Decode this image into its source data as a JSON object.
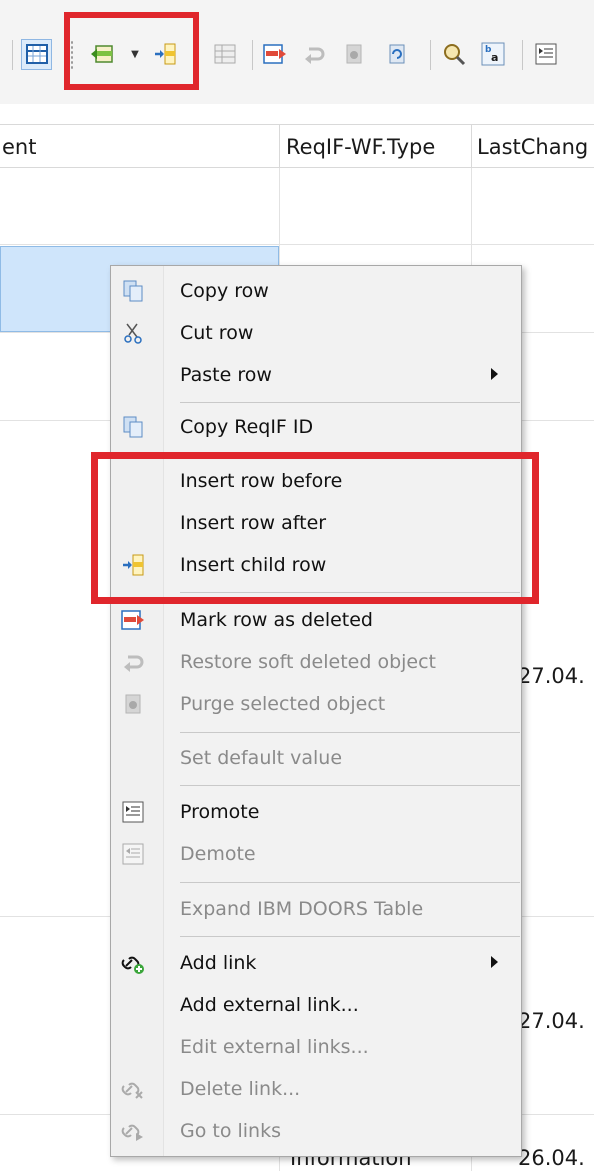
{
  "toolbar": {
    "icons": [
      "table-view-icon",
      "insert-row-before-icon",
      "dropdown-arrow-icon",
      "insert-child-row-icon",
      "table-grid-icon",
      "mark-deleted-icon",
      "undo-arrow-icon",
      "purge-icon",
      "refresh-icon",
      "search-icon",
      "find-replace-icon",
      "promote-icon"
    ]
  },
  "table": {
    "headers": {
      "col1": "ent",
      "col2": "ReqIF-WF.Type",
      "col3": "LastChang"
    },
    "cells": {
      "date1": "27.04.",
      "date2": "27.04.",
      "date3": "26.04.",
      "type_bottom": "Information"
    }
  },
  "menu": {
    "items": [
      {
        "label": "Copy row",
        "icon": "copy-icon",
        "disabled": false
      },
      {
        "label": "Cut row",
        "icon": "scissors-icon",
        "disabled": false
      },
      {
        "label": "Paste row",
        "icon": "",
        "disabled": false,
        "submenu": true
      },
      {
        "label": "Copy ReqIF ID",
        "icon": "copy-icon",
        "disabled": false
      },
      {
        "label": "Insert row before",
        "icon": "",
        "disabled": false
      },
      {
        "label": "Insert row after",
        "icon": "",
        "disabled": false
      },
      {
        "label": "Insert child row",
        "icon": "insert-child-row-icon",
        "disabled": false
      },
      {
        "label": "Mark row as deleted",
        "icon": "mark-deleted-icon",
        "disabled": false
      },
      {
        "label": "Restore soft deleted object",
        "icon": "undo-arrow-icon",
        "disabled": true
      },
      {
        "label": "Purge selected object",
        "icon": "purge-icon",
        "disabled": true
      },
      {
        "label": "Set default value",
        "icon": "",
        "disabled": true
      },
      {
        "label": "Promote",
        "icon": "promote-icon",
        "disabled": false
      },
      {
        "label": "Demote",
        "icon": "demote-icon",
        "disabled": true
      },
      {
        "label": "Expand IBM DOORS Table",
        "icon": "",
        "disabled": true
      },
      {
        "label": "Add link",
        "icon": "add-link-icon",
        "disabled": false,
        "submenu": true
      },
      {
        "label": "Add external link...",
        "icon": "",
        "disabled": false
      },
      {
        "label": "Edit external links...",
        "icon": "",
        "disabled": true
      },
      {
        "label": "Delete link...",
        "icon": "delete-link-icon",
        "disabled": true
      },
      {
        "label": "Go to links",
        "icon": "go-to-links-icon",
        "disabled": true
      }
    ]
  },
  "colors": {
    "highlight": "#e0262c",
    "selection": "#cfe5fb",
    "disabled_text": "#8a8a8a"
  }
}
